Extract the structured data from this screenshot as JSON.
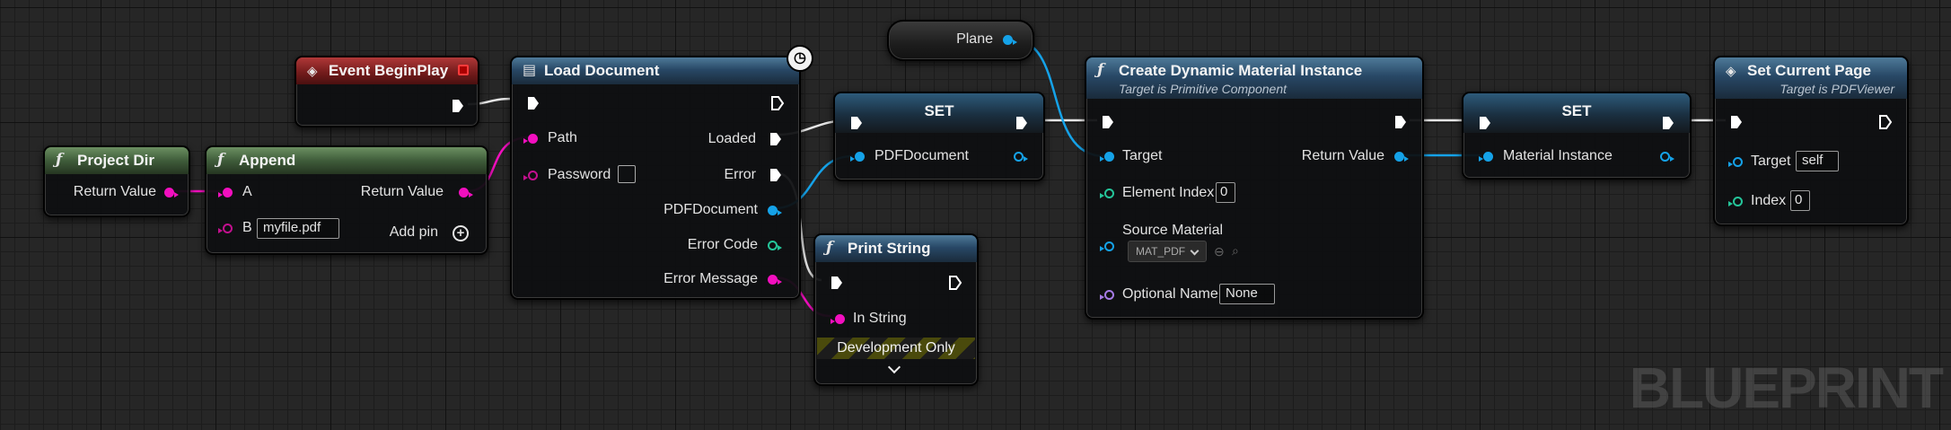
{
  "watermark": "BLUEPRINT",
  "colors": {
    "exec": "#ffffff",
    "string_pin": "#f30fbf",
    "object_pin": "#15a2e8",
    "int_pin": "#25c59a",
    "name_pin": "#a67be6",
    "func_header": "#284866",
    "pure_header": "#3f5c3a",
    "event_header": "#751c1c"
  },
  "nodes": {
    "project_dir": {
      "icon": "function-icon",
      "title": "Project Dir",
      "out_return": "Return Value"
    },
    "append": {
      "icon": "function-icon",
      "title": "Append",
      "in_a": "A",
      "in_b": "B",
      "b_value": "myfile.pdf",
      "out_return": "Return Value",
      "add_pin": "Add pin"
    },
    "event_begin_play": {
      "icon": "event-icon",
      "title": "Event BeginPlay"
    },
    "load_document": {
      "icon": "function-icon",
      "title": "Load Document",
      "in_path": "Path",
      "in_password": "Password",
      "out_loaded": "Loaded",
      "out_error": "Error",
      "out_pdf": "PDFDocument",
      "out_error_code": "Error Code",
      "out_error_msg": "Error Message"
    },
    "plane": {
      "label": "Plane"
    },
    "set_pdf": {
      "title": "SET",
      "in_var": "PDFDocument"
    },
    "print_string": {
      "icon": "function-icon",
      "title": "Print String",
      "in_string": "In String",
      "dev_only": "Development Only"
    },
    "create_dmi": {
      "icon": "function-icon",
      "title": "Create Dynamic Material Instance",
      "subtitle": "Target is Primitive Component",
      "in_target": "Target",
      "out_return": "Return Value",
      "in_element_index": "Element Index",
      "element_index_value": "0",
      "in_source_material": "Source Material",
      "source_material_value": "MAT_PDF",
      "in_optional_name": "Optional Name",
      "optional_name_value": "None"
    },
    "set_mat": {
      "title": "SET",
      "in_var": "Material Instance"
    },
    "set_current_page": {
      "icon": "event-icon",
      "title": "Set Current Page",
      "subtitle": "Target is PDFViewer",
      "in_target": "Target",
      "target_value": "self",
      "in_index": "Index",
      "index_value": "0"
    }
  }
}
